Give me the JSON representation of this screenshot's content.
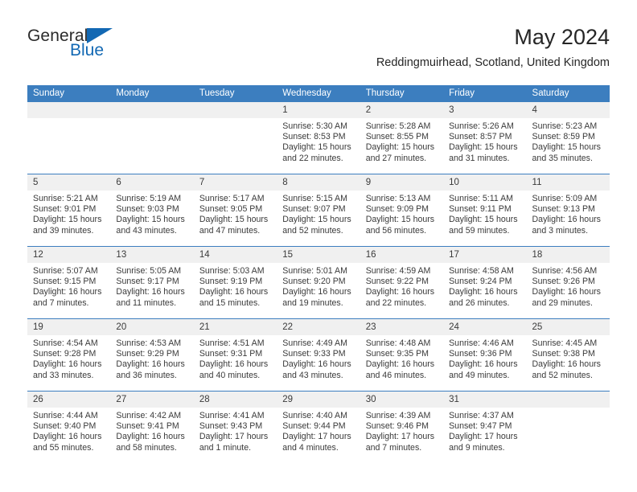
{
  "brand": {
    "name_part1": "General",
    "name_part2": "Blue",
    "triangle_color": "#1268b3"
  },
  "header": {
    "title": "May 2024",
    "subtitle": "Reddingmuirhead, Scotland, United Kingdom"
  },
  "theme": {
    "header_blue": "#3c7ebf",
    "daynum_background": "#f0f0f0",
    "text_color": "#3a3a3a"
  },
  "weekday_headers": [
    "Sunday",
    "Monday",
    "Tuesday",
    "Wednesday",
    "Thursday",
    "Friday",
    "Saturday"
  ],
  "labels": {
    "sunrise_prefix": "Sunrise: ",
    "sunset_prefix": "Sunset: ",
    "daylight_prefix": "Daylight: "
  },
  "weeks": [
    [
      {
        "day": "",
        "blank": true,
        "sunrise": "",
        "sunset": "",
        "daylight": ""
      },
      {
        "day": "",
        "blank": true,
        "sunrise": "",
        "sunset": "",
        "daylight": ""
      },
      {
        "day": "",
        "blank": true,
        "sunrise": "",
        "sunset": "",
        "daylight": ""
      },
      {
        "day": "1",
        "sunrise": "Sunrise: 5:30 AM",
        "sunset": "Sunset: 8:53 PM",
        "daylight": "Daylight: 15 hours and 22 minutes."
      },
      {
        "day": "2",
        "sunrise": "Sunrise: 5:28 AM",
        "sunset": "Sunset: 8:55 PM",
        "daylight": "Daylight: 15 hours and 27 minutes."
      },
      {
        "day": "3",
        "sunrise": "Sunrise: 5:26 AM",
        "sunset": "Sunset: 8:57 PM",
        "daylight": "Daylight: 15 hours and 31 minutes."
      },
      {
        "day": "4",
        "sunrise": "Sunrise: 5:23 AM",
        "sunset": "Sunset: 8:59 PM",
        "daylight": "Daylight: 15 hours and 35 minutes."
      }
    ],
    [
      {
        "day": "5",
        "sunrise": "Sunrise: 5:21 AM",
        "sunset": "Sunset: 9:01 PM",
        "daylight": "Daylight: 15 hours and 39 minutes."
      },
      {
        "day": "6",
        "sunrise": "Sunrise: 5:19 AM",
        "sunset": "Sunset: 9:03 PM",
        "daylight": "Daylight: 15 hours and 43 minutes."
      },
      {
        "day": "7",
        "sunrise": "Sunrise: 5:17 AM",
        "sunset": "Sunset: 9:05 PM",
        "daylight": "Daylight: 15 hours and 47 minutes."
      },
      {
        "day": "8",
        "sunrise": "Sunrise: 5:15 AM",
        "sunset": "Sunset: 9:07 PM",
        "daylight": "Daylight: 15 hours and 52 minutes."
      },
      {
        "day": "9",
        "sunrise": "Sunrise: 5:13 AM",
        "sunset": "Sunset: 9:09 PM",
        "daylight": "Daylight: 15 hours and 56 minutes."
      },
      {
        "day": "10",
        "sunrise": "Sunrise: 5:11 AM",
        "sunset": "Sunset: 9:11 PM",
        "daylight": "Daylight: 15 hours and 59 minutes."
      },
      {
        "day": "11",
        "sunrise": "Sunrise: 5:09 AM",
        "sunset": "Sunset: 9:13 PM",
        "daylight": "Daylight: 16 hours and 3 minutes."
      }
    ],
    [
      {
        "day": "12",
        "sunrise": "Sunrise: 5:07 AM",
        "sunset": "Sunset: 9:15 PM",
        "daylight": "Daylight: 16 hours and 7 minutes."
      },
      {
        "day": "13",
        "sunrise": "Sunrise: 5:05 AM",
        "sunset": "Sunset: 9:17 PM",
        "daylight": "Daylight: 16 hours and 11 minutes."
      },
      {
        "day": "14",
        "sunrise": "Sunrise: 5:03 AM",
        "sunset": "Sunset: 9:19 PM",
        "daylight": "Daylight: 16 hours and 15 minutes."
      },
      {
        "day": "15",
        "sunrise": "Sunrise: 5:01 AM",
        "sunset": "Sunset: 9:20 PM",
        "daylight": "Daylight: 16 hours and 19 minutes."
      },
      {
        "day": "16",
        "sunrise": "Sunrise: 4:59 AM",
        "sunset": "Sunset: 9:22 PM",
        "daylight": "Daylight: 16 hours and 22 minutes."
      },
      {
        "day": "17",
        "sunrise": "Sunrise: 4:58 AM",
        "sunset": "Sunset: 9:24 PM",
        "daylight": "Daylight: 16 hours and 26 minutes."
      },
      {
        "day": "18",
        "sunrise": "Sunrise: 4:56 AM",
        "sunset": "Sunset: 9:26 PM",
        "daylight": "Daylight: 16 hours and 29 minutes."
      }
    ],
    [
      {
        "day": "19",
        "sunrise": "Sunrise: 4:54 AM",
        "sunset": "Sunset: 9:28 PM",
        "daylight": "Daylight: 16 hours and 33 minutes."
      },
      {
        "day": "20",
        "sunrise": "Sunrise: 4:53 AM",
        "sunset": "Sunset: 9:29 PM",
        "daylight": "Daylight: 16 hours and 36 minutes."
      },
      {
        "day": "21",
        "sunrise": "Sunrise: 4:51 AM",
        "sunset": "Sunset: 9:31 PM",
        "daylight": "Daylight: 16 hours and 40 minutes."
      },
      {
        "day": "22",
        "sunrise": "Sunrise: 4:49 AM",
        "sunset": "Sunset: 9:33 PM",
        "daylight": "Daylight: 16 hours and 43 minutes."
      },
      {
        "day": "23",
        "sunrise": "Sunrise: 4:48 AM",
        "sunset": "Sunset: 9:35 PM",
        "daylight": "Daylight: 16 hours and 46 minutes."
      },
      {
        "day": "24",
        "sunrise": "Sunrise: 4:46 AM",
        "sunset": "Sunset: 9:36 PM",
        "daylight": "Daylight: 16 hours and 49 minutes."
      },
      {
        "day": "25",
        "sunrise": "Sunrise: 4:45 AM",
        "sunset": "Sunset: 9:38 PM",
        "daylight": "Daylight: 16 hours and 52 minutes."
      }
    ],
    [
      {
        "day": "26",
        "sunrise": "Sunrise: 4:44 AM",
        "sunset": "Sunset: 9:40 PM",
        "daylight": "Daylight: 16 hours and 55 minutes."
      },
      {
        "day": "27",
        "sunrise": "Sunrise: 4:42 AM",
        "sunset": "Sunset: 9:41 PM",
        "daylight": "Daylight: 16 hours and 58 minutes."
      },
      {
        "day": "28",
        "sunrise": "Sunrise: 4:41 AM",
        "sunset": "Sunset: 9:43 PM",
        "daylight": "Daylight: 17 hours and 1 minute."
      },
      {
        "day": "29",
        "sunrise": "Sunrise: 4:40 AM",
        "sunset": "Sunset: 9:44 PM",
        "daylight": "Daylight: 17 hours and 4 minutes."
      },
      {
        "day": "30",
        "sunrise": "Sunrise: 4:39 AM",
        "sunset": "Sunset: 9:46 PM",
        "daylight": "Daylight: 17 hours and 7 minutes."
      },
      {
        "day": "31",
        "sunrise": "Sunrise: 4:37 AM",
        "sunset": "Sunset: 9:47 PM",
        "daylight": "Daylight: 17 hours and 9 minutes."
      },
      {
        "day": "",
        "blank": true,
        "sunrise": "",
        "sunset": "",
        "daylight": ""
      }
    ]
  ]
}
